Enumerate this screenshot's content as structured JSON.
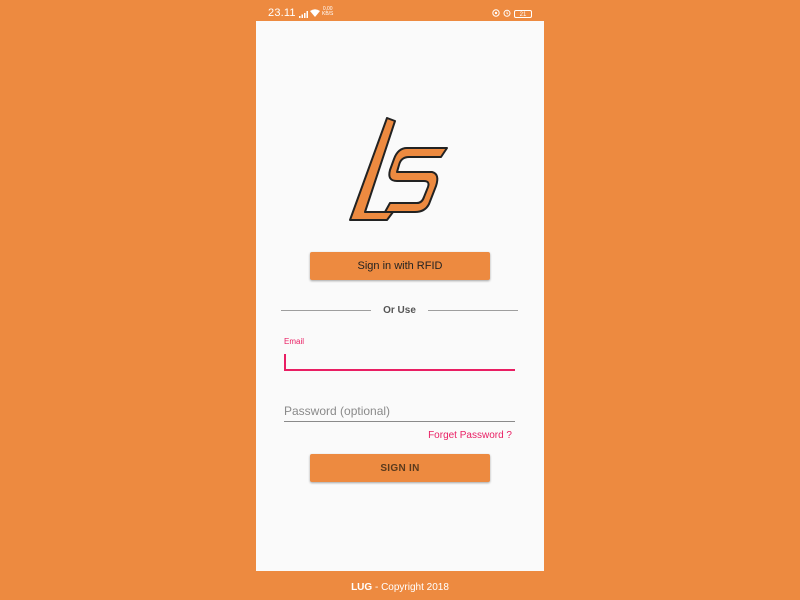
{
  "status_bar": {
    "time": "23.11",
    "network_speed_top": "0,00",
    "network_speed_bottom": "KB/S",
    "battery_level": "21"
  },
  "main": {
    "rfid_button_label": "Sign in with RFID",
    "divider_text": "Or Use",
    "email_label": "Email",
    "email_value": "",
    "password_placeholder": "Password (optional)",
    "forgot_password": "Forget Password ?",
    "signin_button_label": "SIGN IN"
  },
  "footer": {
    "brand": "LUG",
    "text": " - Copyright 2018"
  },
  "colors": {
    "background": "#ED8A40",
    "accent": "#E91E63",
    "card": "#FAFAFA"
  }
}
